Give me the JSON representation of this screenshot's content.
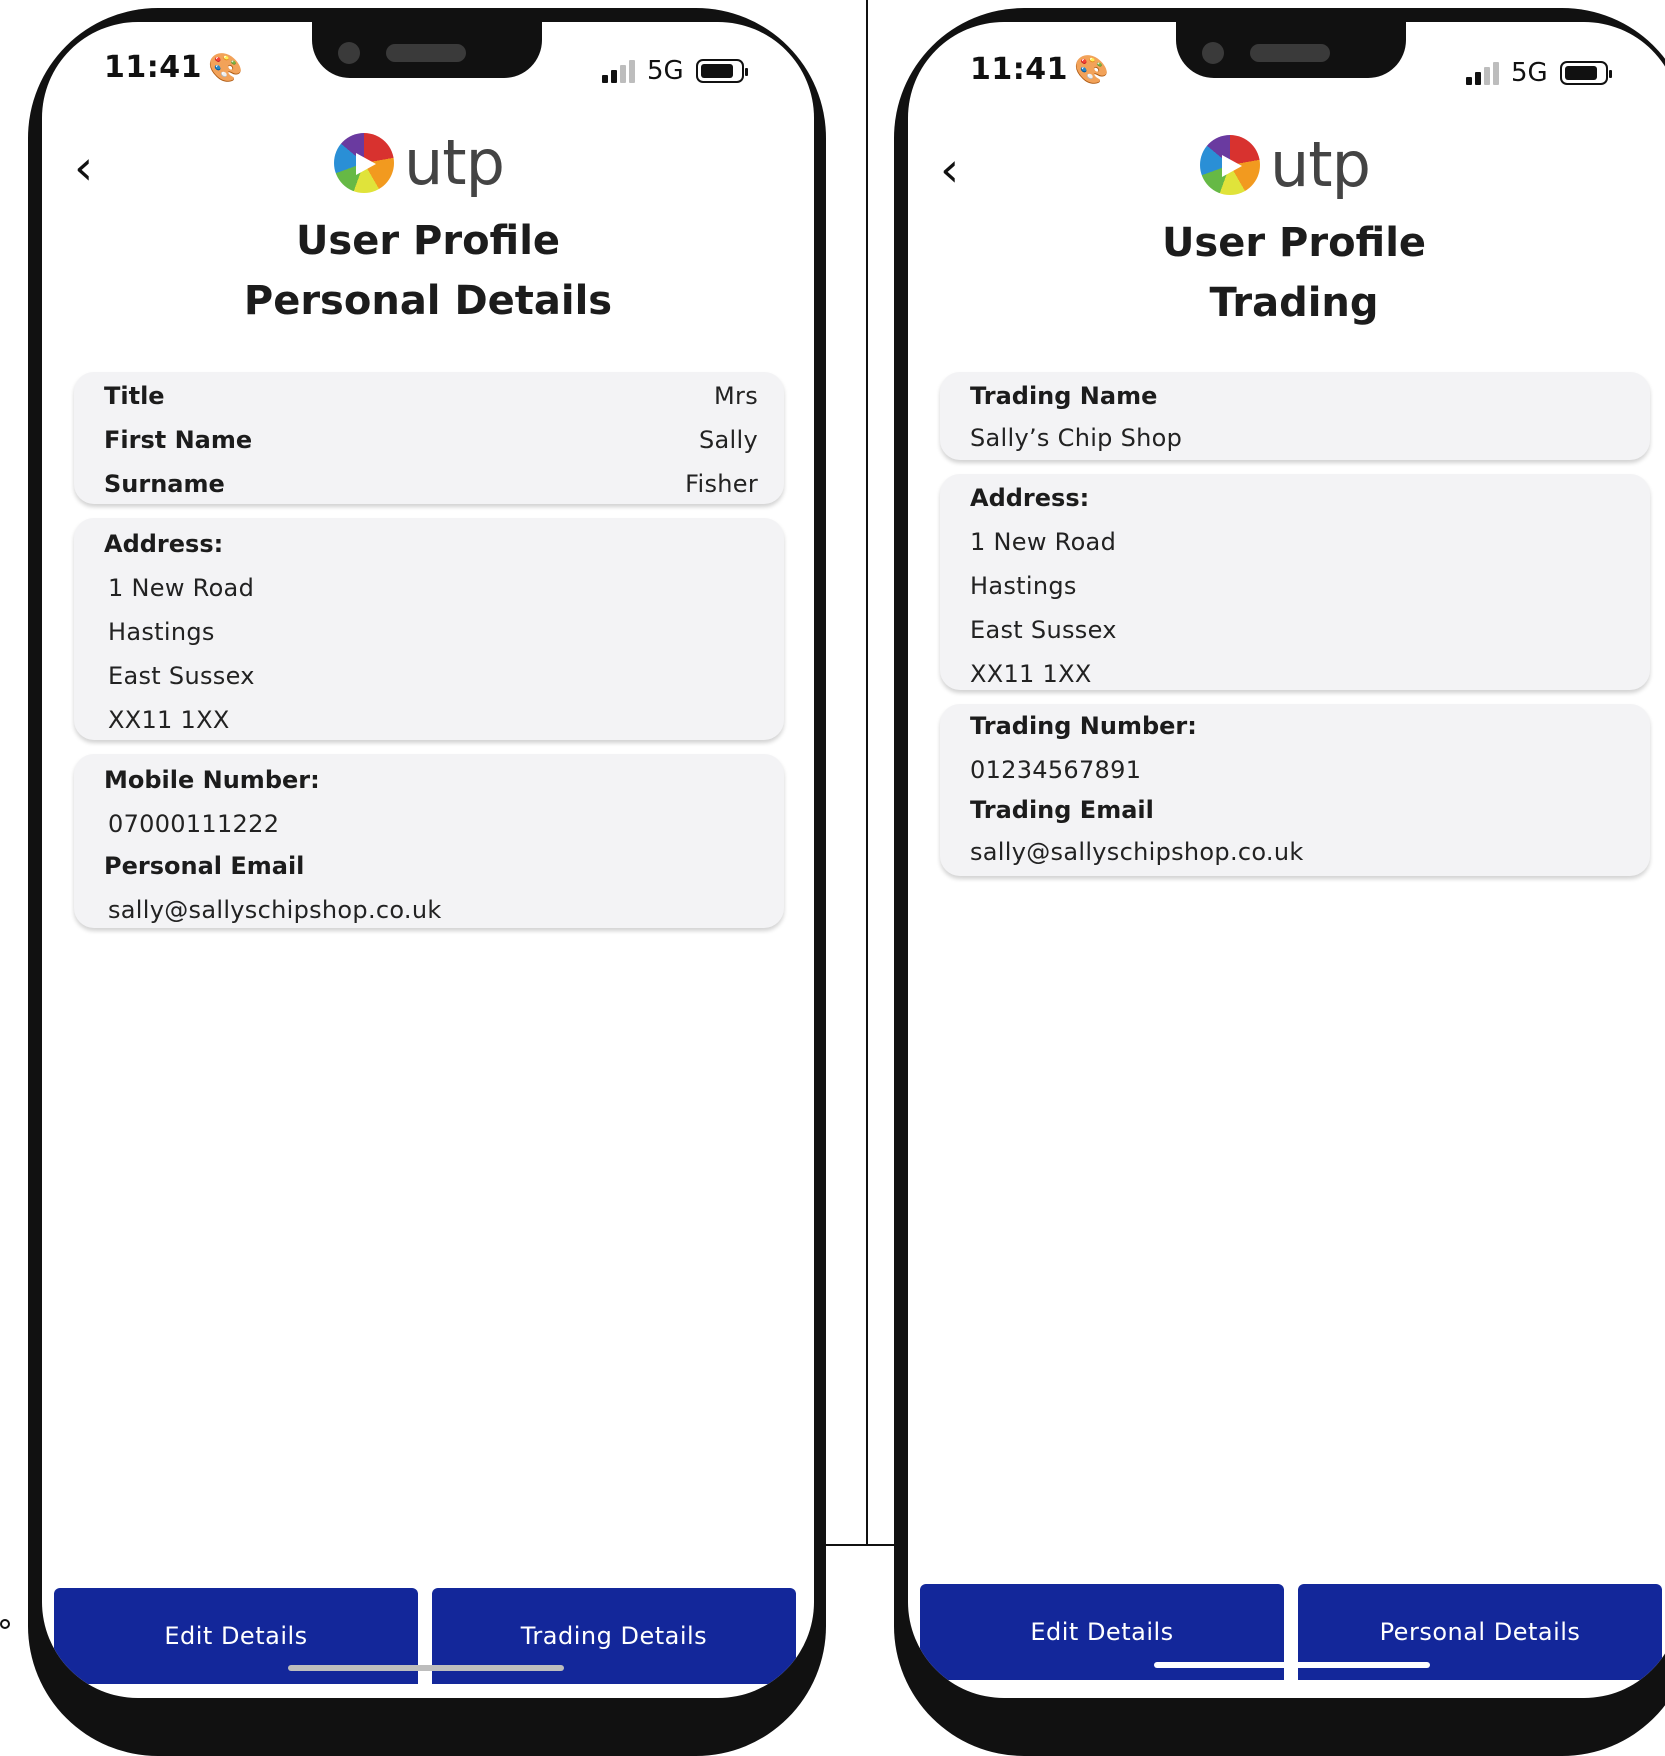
{
  "status_bar": {
    "time": "11:41",
    "network": "5G"
  },
  "brand": {
    "logo_text": "utp"
  },
  "screen_personal": {
    "title_line1": "User Profile",
    "title_line2": "Personal Details",
    "name_card": {
      "rows": [
        {
          "label": "Title",
          "value": "Mrs"
        },
        {
          "label": "First Name",
          "value": "Sally"
        },
        {
          "label": "Surname",
          "value": "Fisher"
        }
      ]
    },
    "address_card": {
      "label": "Address:",
      "lines": [
        "1 New Road",
        "Hastings",
        "East Sussex",
        "XX11 1XX"
      ]
    },
    "contact_card": {
      "mobile_label": "Mobile Number:",
      "mobile_value": "07000111222",
      "email_label": "Personal Email",
      "email_value": "sally@sallyschipshop.co.uk"
    },
    "buttons": {
      "edit": "Edit Details",
      "switch": "Trading Details"
    }
  },
  "screen_trading": {
    "title_line1": "User Profile",
    "title_line2": "Trading",
    "name_card": {
      "label": "Trading Name",
      "value": "Sally’s Chip Shop"
    },
    "address_card": {
      "label": "Address:",
      "lines": [
        "1 New Road",
        "Hastings",
        "East Sussex",
        "XX11 1XX"
      ]
    },
    "contact_card": {
      "number_label": "Trading Number:",
      "number_value": "01234567891",
      "email_label": "Trading Email",
      "email_value": "sally@sallyschipshop.co.uk"
    },
    "buttons": {
      "edit": "Edit Details",
      "switch": "Personal Details"
    }
  },
  "colors": {
    "button_blue": "#13279a",
    "card_bg": "#f3f3f5",
    "frame": "#111111"
  }
}
